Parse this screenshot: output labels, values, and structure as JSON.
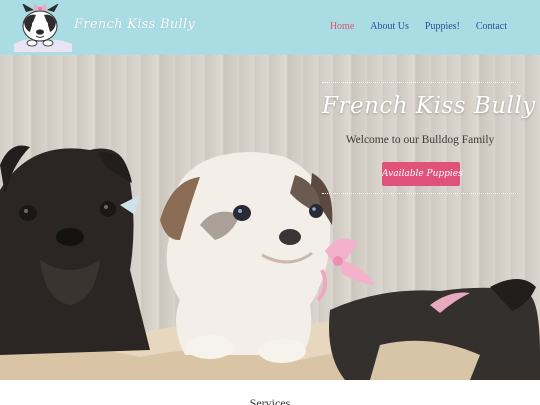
{
  "header": {
    "logo_text": "French Kiss Bully",
    "background": "#a9dce3"
  },
  "nav": {
    "items": [
      {
        "label": "Home",
        "active": true
      },
      {
        "label": "About Us",
        "active": false
      },
      {
        "label": "Puppies!",
        "active": false
      },
      {
        "label": "Contact",
        "active": false
      }
    ],
    "color": "#2a4f9a",
    "active_color": "#e0527a"
  },
  "hero": {
    "title": "French Kiss Bully",
    "subtitle": "Welcome to our Bulldog Family",
    "cta_label": "Available Puppies",
    "cta_color": "#e0527a"
  },
  "services": {
    "heading": "Services"
  }
}
